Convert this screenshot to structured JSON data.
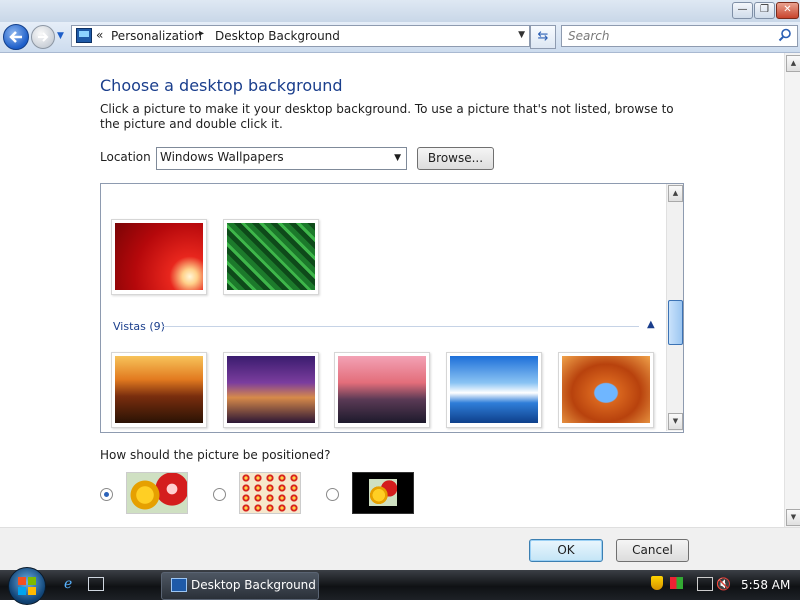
{
  "titlebar": {
    "minimize": "—",
    "maximize": "❐",
    "close": "✕"
  },
  "nav": {
    "address_prefix": "«",
    "breadcrumb": [
      "Personalization",
      "Desktop Background"
    ],
    "crumb_separator": "▸",
    "search_placeholder": "Search"
  },
  "content": {
    "title": "Choose a desktop background",
    "instructions": "Click a picture to make it your desktop background. To use a picture that's not listed, browse to the picture and double click it.",
    "location_label": "Location",
    "location_value": "Windows Wallpapers",
    "browse_label": "Browse...",
    "group_label": "Vistas (9)",
    "position_question": "How should the picture be positioned?",
    "position_selected": 0
  },
  "gallery": {
    "top_row": [
      {
        "icon": "red-flower-wallpaper"
      },
      {
        "icon": "green-circuit-wallpaper"
      }
    ],
    "vistas_row": [
      {
        "icon": "sunset-rocks-wallpaper"
      },
      {
        "icon": "bridge-night-wallpaper"
      },
      {
        "icon": "pink-sunset-coast-wallpaper"
      },
      {
        "icon": "blue-sky-dock-wallpaper"
      },
      {
        "icon": "rock-arch-wallpaper"
      }
    ]
  },
  "footer": {
    "ok": "OK",
    "cancel": "Cancel"
  },
  "taskbar": {
    "task_label": "Desktop Background",
    "clock": "5:58 AM"
  },
  "colors": {
    "accent": "#1a3e8c",
    "taskbar": "#1d2126"
  }
}
